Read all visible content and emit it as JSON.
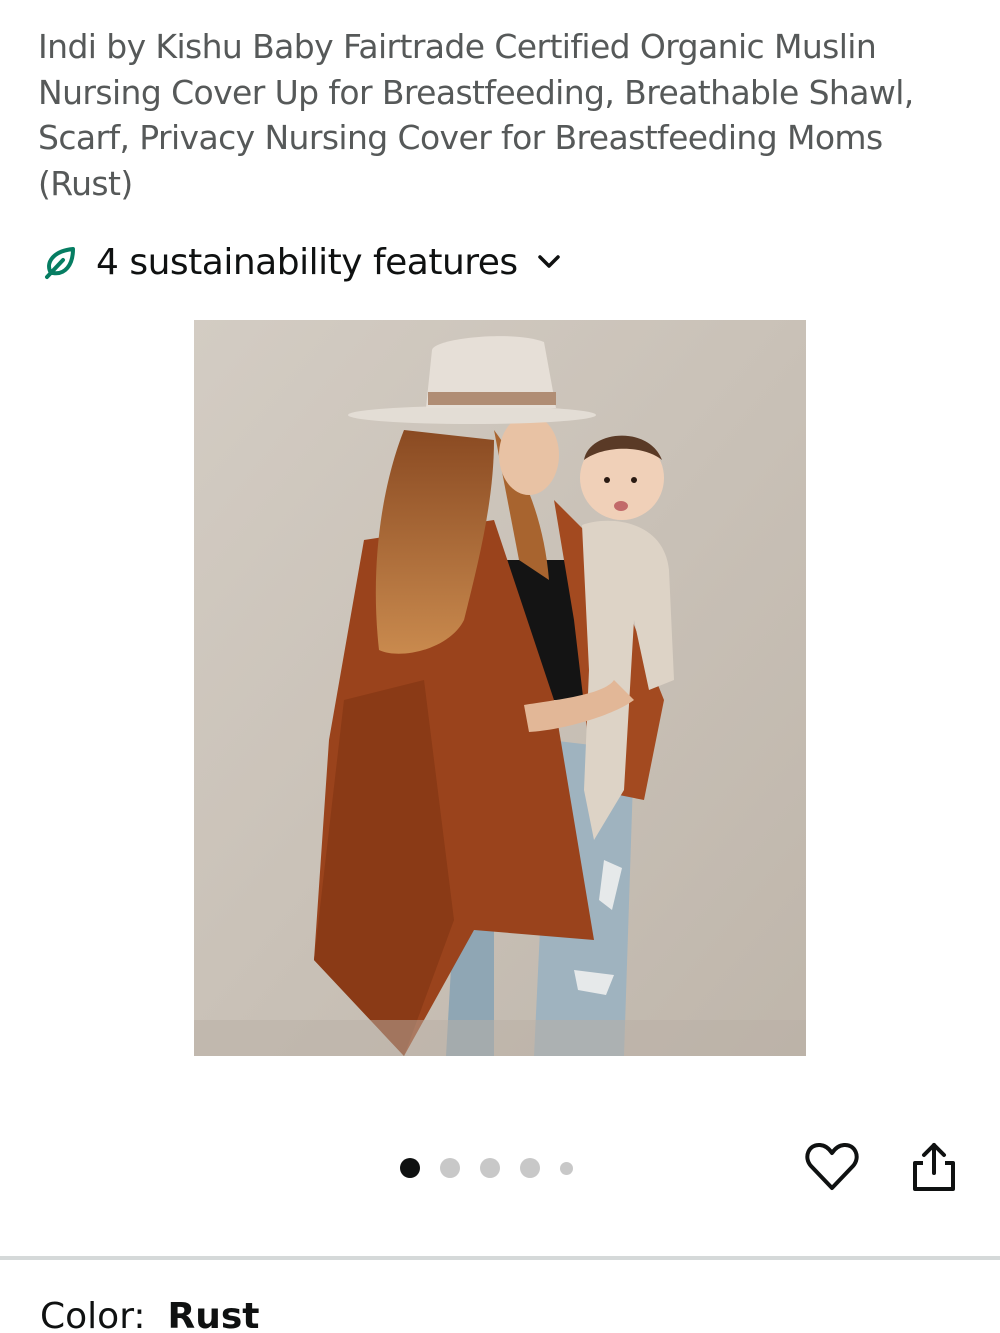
{
  "product": {
    "title": "Indi by Kishu Baby Fairtrade Certified Organic Muslin Nursing Cover Up for Breastfeeding, Breathable Shawl, Scarf, Privacy Nursing Cover for Breastfeeding Moms (Rust)"
  },
  "sustainability": {
    "label": "4 sustainability features",
    "icon": "leaf-icon",
    "accent_color": "#067d62"
  },
  "carousel": {
    "total_images": 5,
    "active_index": 0
  },
  "actions": {
    "wishlist_icon": "heart-icon",
    "share_icon": "share-icon"
  },
  "variation": {
    "color_label": "Color:",
    "color_value": "Rust"
  }
}
